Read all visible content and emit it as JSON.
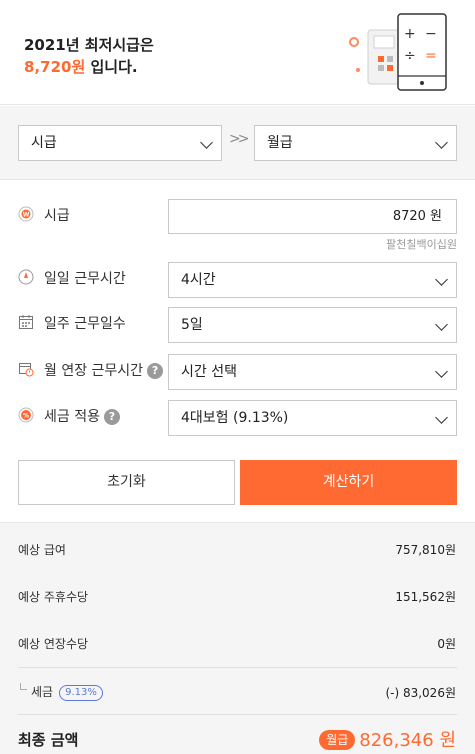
{
  "header": {
    "line1": "2021년 최저시급은",
    "amount": "8,720원",
    "line2_suffix": " 입니다."
  },
  "unit": {
    "from": "시급",
    "to": "월급",
    "arrow": ">>"
  },
  "form": {
    "hourly": {
      "label": "시급",
      "value": "8720 원",
      "hint": "팔천칠백이십원"
    },
    "daily_hours": {
      "label": "일일 근무시간",
      "value": "4시간"
    },
    "weekly_days": {
      "label": "일주 근무일수",
      "value": "5일"
    },
    "overtime": {
      "label": "월 연장 근무시간",
      "value": "시간 선택"
    },
    "tax": {
      "label": "세금 적용",
      "value": "4대보험 (9.13%)"
    }
  },
  "buttons": {
    "reset": "초기화",
    "calculate": "계산하기"
  },
  "results": {
    "salary": {
      "label": "예상 급여",
      "value": "757,810원"
    },
    "weekly_allowance": {
      "label": "예상 주휴수당",
      "value": "151,562원"
    },
    "overtime_allowance": {
      "label": "예상 연장수당",
      "value": "0원"
    },
    "tax": {
      "label": "세금",
      "rate": "9.13%",
      "value": "(-) 83,026원"
    },
    "final": {
      "label": "최종 금액",
      "badge": "월급",
      "value": "826,346 원"
    }
  },
  "colors": {
    "accent": "#ff6a33",
    "badge_blue": "#5b7bd5"
  }
}
